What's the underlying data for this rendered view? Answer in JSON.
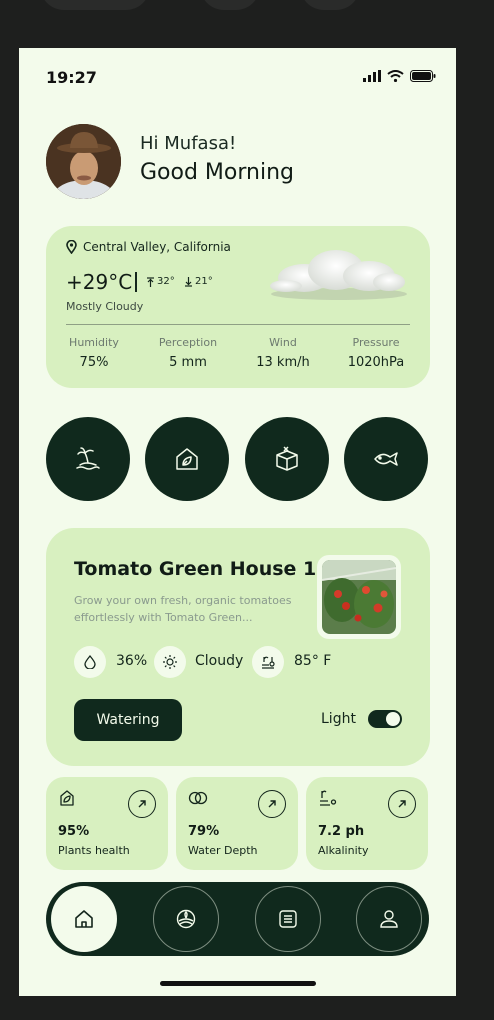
{
  "status": {
    "time": "19:27"
  },
  "greeting": {
    "hello": "Hi Mufasa!",
    "salutation": "Good Morning"
  },
  "weather": {
    "location": "Central Valley, California",
    "temperature": "+29°C",
    "high": "32°",
    "low": "21°",
    "condition": "Mostly Cloudy",
    "stats": [
      {
        "label": "Humidity",
        "value": "75%"
      },
      {
        "label": "Perception",
        "value": "5 mm"
      },
      {
        "label": "Wind",
        "value": "13 km/h"
      },
      {
        "label": "Pressure",
        "value": "1020hPa"
      }
    ]
  },
  "quick_actions": [
    "island-icon",
    "leaf-home-icon",
    "seed-box-icon",
    "fish-icon"
  ],
  "greenhouse": {
    "title": "Tomato Green House 1",
    "description": "Grow your own fresh, organic tomatoes effortlessly with Tomato Green...",
    "humidity": "36%",
    "weather": "Cloudy",
    "temperature": "85° F",
    "watering_label": "Watering",
    "light_label": "Light",
    "light_on": true
  },
  "stats": [
    {
      "icon": "plant-health-icon",
      "value": "95%",
      "label": "Plants health"
    },
    {
      "icon": "water-depth-icon",
      "value": "79%",
      "label": "Water Depth"
    },
    {
      "icon": "alkalinity-icon",
      "value": "7.2 ph",
      "label": "Alkalinity"
    }
  ],
  "nav": [
    "home-icon",
    "farm-icon",
    "list-icon",
    "profile-icon"
  ],
  "colors": {
    "dark": "#10291d",
    "card": "#d8f0c0",
    "background": "#f3fbeb"
  }
}
